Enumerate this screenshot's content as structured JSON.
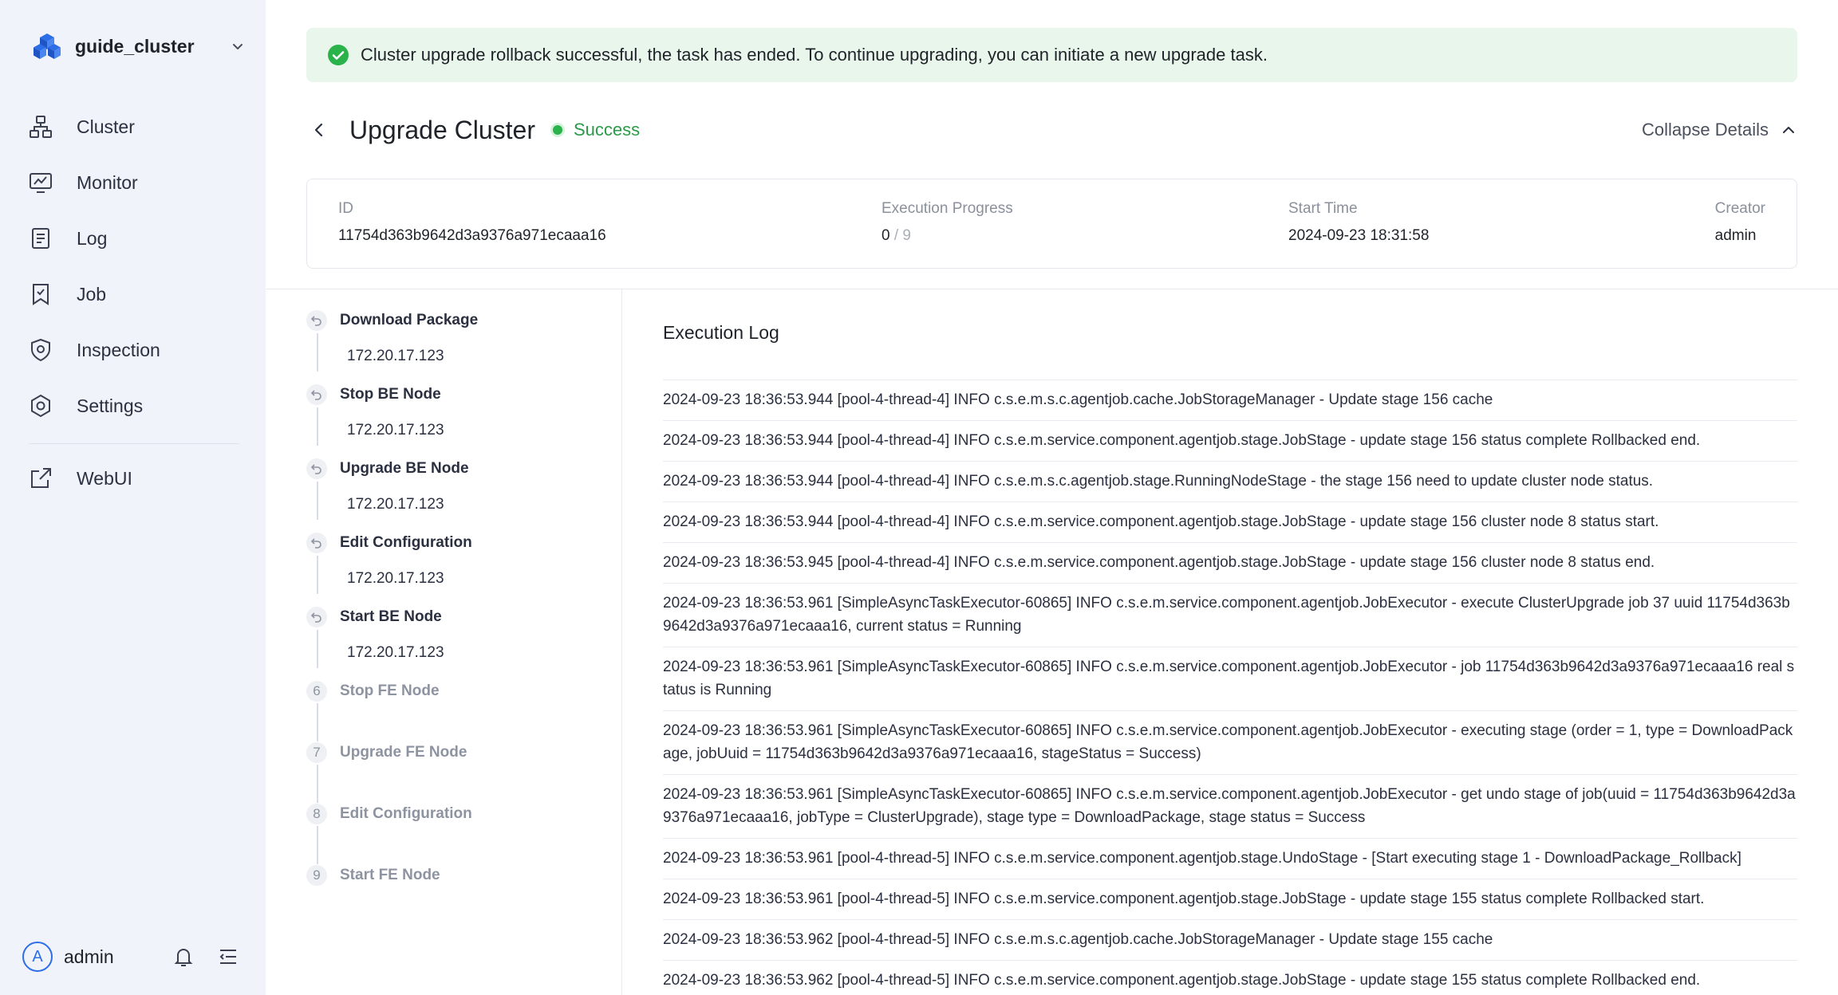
{
  "sidebar": {
    "cluster_name": "guide_cluster",
    "nav": [
      {
        "label": "Cluster",
        "icon": "cluster-icon"
      },
      {
        "label": "Monitor",
        "icon": "monitor-icon"
      },
      {
        "label": "Log",
        "icon": "log-icon"
      },
      {
        "label": "Job",
        "icon": "job-icon"
      },
      {
        "label": "Inspection",
        "icon": "inspection-icon"
      },
      {
        "label": "Settings",
        "icon": "settings-icon"
      }
    ],
    "webui_label": "WebUI",
    "user": {
      "initial": "A",
      "name": "admin"
    }
  },
  "banner": {
    "message": "Cluster upgrade rollback successful, the task has ended. To continue upgrading, you can initiate a new upgrade task."
  },
  "header": {
    "title": "Upgrade Cluster",
    "status": "Success",
    "collapse_label": "Collapse Details"
  },
  "details": {
    "id_label": "ID",
    "id_value": "11754d363b9642d3a9376a971ecaaa16",
    "progress_label": "Execution Progress",
    "progress_done": "0",
    "progress_total": "/ 9",
    "start_label": "Start Time",
    "start_value": "2024-09-23 18:31:58",
    "creator_label": "Creator",
    "creator_value": "admin"
  },
  "steps": [
    {
      "label": "Download Package",
      "state": "rollback",
      "host": "172.20.17.123"
    },
    {
      "label": "Stop BE Node",
      "state": "rollback",
      "host": "172.20.17.123"
    },
    {
      "label": "Upgrade BE Node",
      "state": "rollback",
      "host": "172.20.17.123"
    },
    {
      "label": "Edit Configuration",
      "state": "rollback",
      "host": "172.20.17.123"
    },
    {
      "label": "Start BE Node",
      "state": "rollback",
      "host": "172.20.17.123"
    },
    {
      "number": "6",
      "label": "Stop FE Node",
      "state": "pending"
    },
    {
      "number": "7",
      "label": "Upgrade FE Node",
      "state": "pending"
    },
    {
      "number": "8",
      "label": "Edit Configuration",
      "state": "pending"
    },
    {
      "number": "9",
      "label": "Start FE Node",
      "state": "pending"
    }
  ],
  "log": {
    "title": "Execution Log",
    "lines": [
      "2024-09-23 18:36:53.944 [pool-4-thread-4] INFO  c.s.e.m.s.c.agentjob.cache.JobStorageManager - Update stage 156 cache",
      "2024-09-23 18:36:53.944 [pool-4-thread-4] INFO  c.s.e.m.service.component.agentjob.stage.JobStage - update stage 156 status complete Rollbacked end.",
      "2024-09-23 18:36:53.944 [pool-4-thread-4] INFO  c.s.e.m.s.c.agentjob.stage.RunningNodeStage - the stage 156 need to update cluster node status.",
      "2024-09-23 18:36:53.944 [pool-4-thread-4] INFO  c.s.e.m.service.component.agentjob.stage.JobStage - update stage 156 cluster node 8 status start.",
      "2024-09-23 18:36:53.945 [pool-4-thread-4] INFO  c.s.e.m.service.component.agentjob.stage.JobStage - update stage 156 cluster node 8 status end.",
      "2024-09-23 18:36:53.961 [SimpleAsyncTaskExecutor-60865] INFO  c.s.e.m.service.component.agentjob.JobExecutor - execute ClusterUpgrade job 37 uuid 11754d363b9642d3a9376a971ecaaa16, current status = Running",
      "2024-09-23 18:36:53.961 [SimpleAsyncTaskExecutor-60865] INFO  c.s.e.m.service.component.agentjob.JobExecutor - job 11754d363b9642d3a9376a971ecaaa16 real status is Running",
      "2024-09-23 18:36:53.961 [SimpleAsyncTaskExecutor-60865] INFO  c.s.e.m.service.component.agentjob.JobExecutor - executing stage (order = 1, type = DownloadPackage, jobUuid = 11754d363b9642d3a9376a971ecaaa16, stageStatus = Success)",
      "2024-09-23 18:36:53.961 [SimpleAsyncTaskExecutor-60865] INFO  c.s.e.m.service.component.agentjob.JobExecutor - get undo stage of job(uuid = 11754d363b9642d3a9376a971ecaaa16, jobType = ClusterUpgrade), stage type = DownloadPackage, stage status = Success",
      "2024-09-23 18:36:53.961 [pool-4-thread-5] INFO c.s.e.m.service.component.agentjob.stage.UndoStage - [Start executing stage 1 - DownloadPackage_Rollback]",
      "2024-09-23 18:36:53.961 [pool-4-thread-5] INFO  c.s.e.m.service.component.agentjob.stage.JobStage - update stage 155 status complete Rollbacked start.",
      "2024-09-23 18:36:53.962 [pool-4-thread-5] INFO  c.s.e.m.s.c.agentjob.cache.JobStorageManager - Update stage 155 cache",
      "2024-09-23 18:36:53.962 [pool-4-thread-5] INFO  c.s.e.m.service.component.agentjob.stage.JobStage - update stage 155 status complete Rollbacked end."
    ]
  }
}
